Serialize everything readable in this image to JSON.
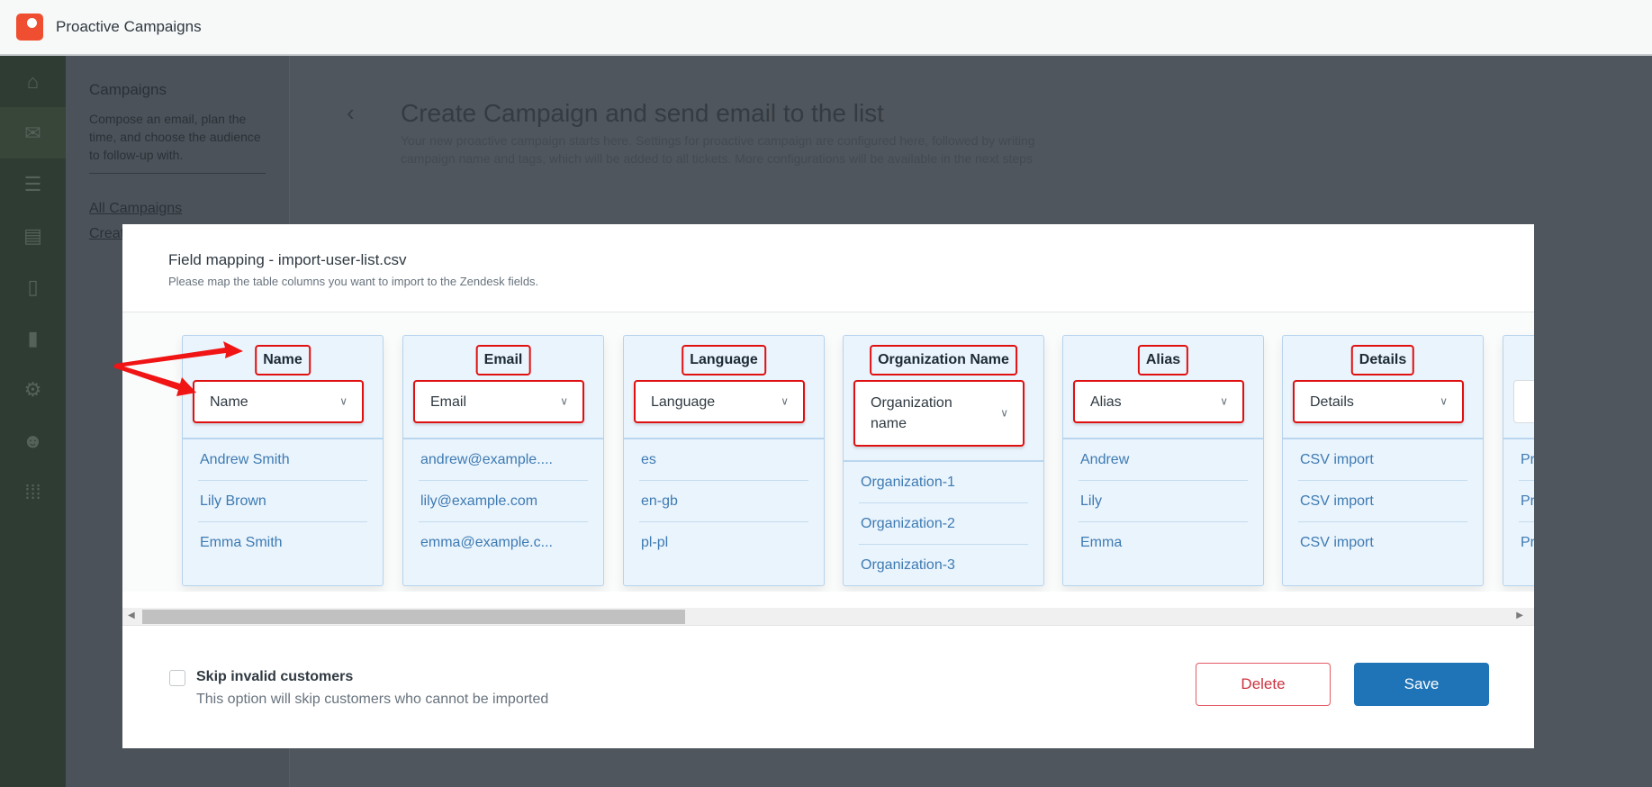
{
  "app": {
    "title": "Proactive Campaigns"
  },
  "nav": [
    "home-icon",
    "mail-icon",
    "contacts-icon",
    "inbox-icon",
    "document-icon",
    "reports-icon",
    "gear-icon",
    "user-lock-icon",
    "apps-icon"
  ],
  "side": {
    "title": "Campaigns",
    "desc": "Compose an email, plan the time, and choose the audience to follow-up with.",
    "links": [
      "All Campaigns",
      "Create"
    ]
  },
  "page": {
    "title": "Create Campaign and send email to the list",
    "desc": "Your new proactive campaign starts here. Settings for proactive campaign are configured here, followed by writing campaign name and tags, which will be added to all tickets. More configurations will be available in the next steps"
  },
  "modal": {
    "title": "Field mapping - import-user-list.csv",
    "subtitle": "Please map the table columns you want to import to the Zendesk fields.",
    "columns": [
      {
        "header": "Name",
        "selected": "Name",
        "rows": [
          "Andrew Smith",
          "Lily Brown",
          "Emma Smith"
        ]
      },
      {
        "header": "Email",
        "selected": "Email",
        "rows": [
          "andrew@example....",
          "lily@example.com",
          "emma@example.c..."
        ]
      },
      {
        "header": "Language",
        "selected": "Language",
        "rows": [
          "es",
          "en-gb",
          "pl-pl"
        ]
      },
      {
        "header": "Organization Name",
        "selected": "Organization name",
        "rows": [
          "Organization-1",
          "Organization-2",
          "Organization-3"
        ]
      },
      {
        "header": "Alias",
        "selected": "Alias",
        "rows": [
          "Andrew",
          "Lily",
          "Emma"
        ]
      },
      {
        "header": "Details",
        "selected": "Details",
        "rows": [
          "CSV import",
          "CSV import",
          "CSV import"
        ]
      },
      {
        "header": "",
        "selected": "",
        "rows": [
          "Pre",
          "Pre",
          "Pre"
        ]
      }
    ],
    "skip_label": "Skip invalid customers",
    "skip_desc": "This option will skip customers who cannot be imported",
    "skip_checked": false,
    "delete_label": "Delete",
    "save_label": "Save"
  },
  "colors": {
    "accent": "#1f73b7",
    "danger": "#cc3340",
    "highlight": "#e01010"
  }
}
